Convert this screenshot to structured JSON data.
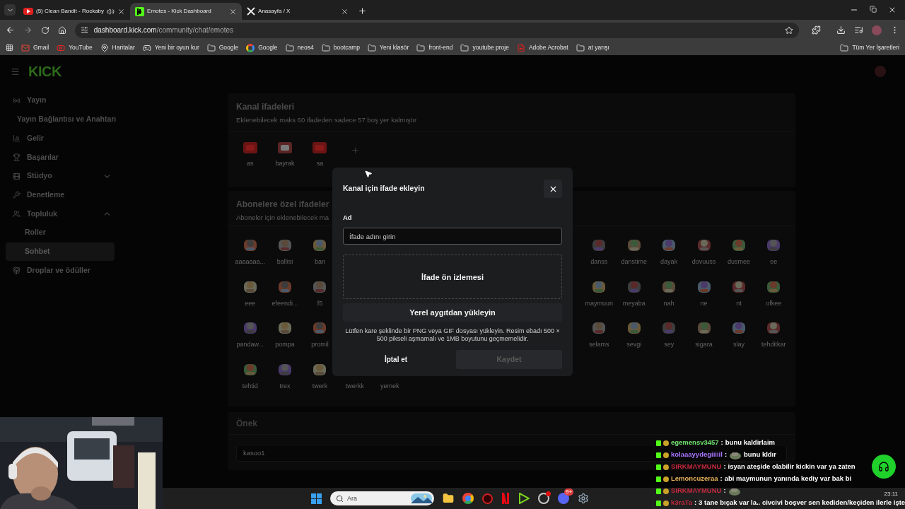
{
  "browser": {
    "tabs": [
      {
        "title": "(5) Clean Bandit - Rockaby",
        "kind": "youtube",
        "playing_audio": true,
        "selected": false
      },
      {
        "title": "Emotes - Kick Dashboard",
        "kind": "kick",
        "playing_audio": false,
        "selected": true
      },
      {
        "title": "Anasayfa / X",
        "kind": "x",
        "playing_audio": false,
        "selected": false
      }
    ],
    "url": {
      "host": "dashboard.kick.com",
      "path": "/community/chat/emotes"
    },
    "bookmarks": [
      {
        "label": "Gmail",
        "kind": "gmail"
      },
      {
        "label": "YouTube",
        "kind": "youtube"
      },
      {
        "label": "Haritalar",
        "kind": "maps"
      },
      {
        "label": "Yeni bir oyun kur",
        "kind": "game"
      },
      {
        "label": "Google",
        "kind": "folder"
      },
      {
        "label": "Google",
        "kind": "google"
      },
      {
        "label": "neos4",
        "kind": "folder"
      },
      {
        "label": "bootcamp",
        "kind": "folder"
      },
      {
        "label": "Yeni klasör",
        "kind": "folder"
      },
      {
        "label": "front-end",
        "kind": "folder"
      },
      {
        "label": "youtube proje",
        "kind": "folder"
      },
      {
        "label": "Adobe Acrobat",
        "kind": "adobe"
      },
      {
        "label": "at yarışı",
        "kind": "folder"
      }
    ],
    "all_bookmarks": "Tüm Yer İşaretleri"
  },
  "sidebar": {
    "logo": "KICK",
    "items": [
      {
        "label": "Yayın",
        "selected": false,
        "children": [
          {
            "label": "Yayın Bağlantısı ve Anahtarı",
            "selected": false
          }
        ]
      },
      {
        "label": "Gelir",
        "selected": false
      },
      {
        "label": "Başarılar",
        "selected": false
      },
      {
        "label": "Stüdyo",
        "selected": false,
        "expanded": false
      },
      {
        "label": "Denetleme",
        "selected": false
      },
      {
        "label": "Topluluk",
        "selected": false,
        "expanded": true,
        "children": [
          {
            "label": "Roller",
            "selected": false
          },
          {
            "label": "Sohbet",
            "selected": true
          }
        ]
      },
      {
        "label": "Droplar ve ödüller",
        "selected": false
      }
    ]
  },
  "channel_emotes": {
    "title": "Kanal ifadeleri",
    "subtitle": "Eklenebilecek maks 60 ifadeden sadece 57 boş yer kalmıştır",
    "emotes": [
      "as",
      "bayrak",
      "sa"
    ]
  },
  "subscriber_emotes": {
    "title": "Abonelere özel ifadeler",
    "subtitle": "Aboneler için eklenebilecek ma",
    "rows": [
      {
        "left": [
          "aaaaaaa...",
          "ballisi",
          "ban"
        ],
        "right": [
          "danss",
          "danstime",
          "dayak",
          "dovuuss",
          "dusmee",
          "ee"
        ]
      },
      {
        "left": [
          "eee",
          "efeendi...",
          "f5"
        ],
        "right": [
          "maymuun",
          "meyaba",
          "nah",
          "ne",
          "nt",
          "ofkee"
        ]
      },
      {
        "left": [
          "pandaw...",
          "pompa",
          "promil"
        ],
        "right": [
          "selams",
          "sevgi",
          "sey",
          "sigara",
          "slay",
          "tehditkar"
        ]
      },
      {
        "left": [
          "tehtid",
          "trex",
          "twerk"
        ],
        "under_dialog": [
          "twerkk",
          "yemek"
        ],
        "right": []
      }
    ]
  },
  "prefix": {
    "title": "Önek",
    "value": "kasoo1"
  },
  "modal": {
    "title": "Kanal için ifade ekleyin",
    "name_label": "Ad",
    "name_placeholder": "İfade adını girin",
    "preview": "İfade ön izlemesi",
    "upload_button": "Yerel aygıtdan yükleyin",
    "help": "Lütfen kare şeklinde bir PNG veya GIF dosyası yükleyin. Resim ebadı 500 × 500 pikseli aşmamalı ve 1MB boyutunu geçmemelidir.",
    "cancel": "İptal et",
    "save": {
      "label": "Kaydet",
      "disabled": true
    }
  },
  "chat_overlay": [
    {
      "user": "egemensv3457",
      "color": "#6ee06e",
      "separator": ":",
      "message": "bunu kaldirlaim",
      "emote": false
    },
    {
      "user": "kolaaayydegiiiiil",
      "color": "#a875ff",
      "separator": ":",
      "message": "bunu kldır",
      "emote": true
    },
    {
      "user": "SIRKMAYMUNU",
      "color": "#c8283f",
      "separator": ":",
      "message": "isyan ateşide olabilir kickin var ya zaten",
      "emote": false
    },
    {
      "user": "Lemoncuzeraa",
      "color": "#e8b45a",
      "separator": ":",
      "message": "abi maymunun yanında kediy var bak bi",
      "emote": false
    },
    {
      "user": "SIRKMAYMUNU",
      "color": "#c8283f",
      "separator": ":",
      "emote": true
    },
    {
      "user": "k3raTa",
      "color": "#c8283f",
      "separator": ":",
      "message": "3 tane bıçak var la.. civcivi boşver sen kediden/keçiden ilerle işte",
      "emote": false
    }
  ],
  "taskbar": {
    "search_placeholder": "Ara",
    "discord_badge": "9+",
    "clock": "23:11"
  }
}
